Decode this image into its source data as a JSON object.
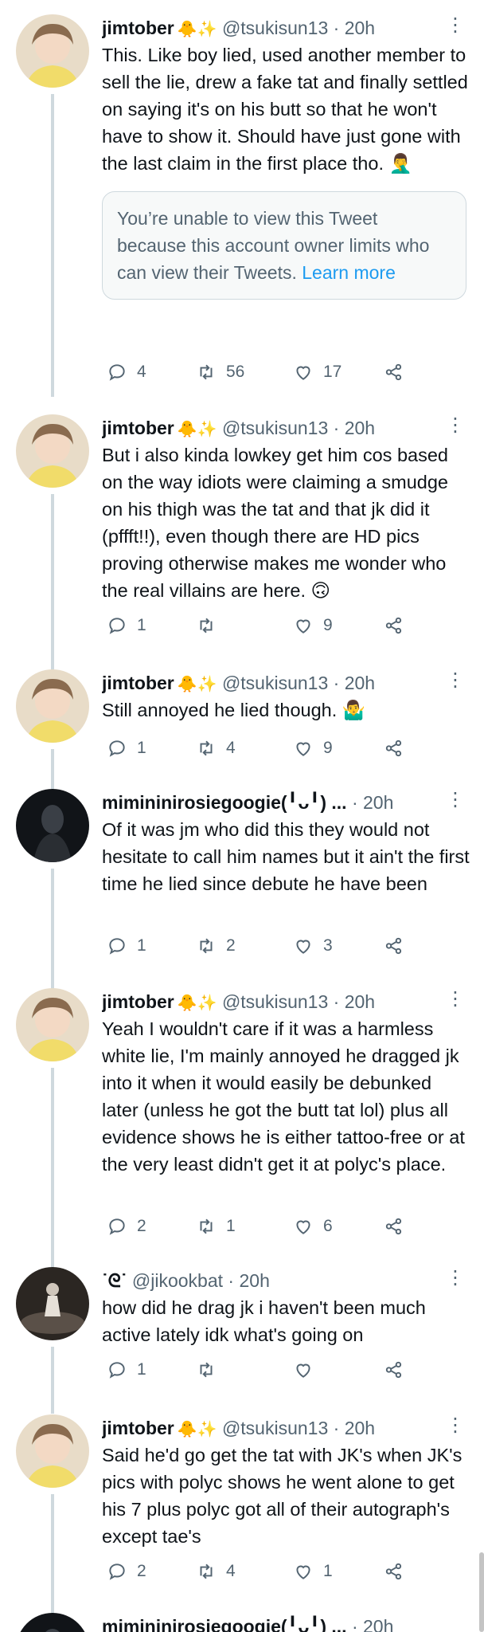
{
  "tweets": [
    {
      "name": "jimtober",
      "emoji": "🐥✨",
      "handle": "@tsukisun13",
      "sep": "·",
      "time": "20h",
      "text": "This. Like boy lied, used another member to sell the lie, drew a fake tat and finally settled on saying it's on his butt so that he won't have to show it. Should have just gone with the last claim in the first place tho. 🤦‍♂️",
      "quote": {
        "text": "You’re unable to view this Tweet because this account owner limits who can view their Tweets.",
        "link": "Learn more"
      },
      "replies": "4",
      "retweets": "56",
      "likes": "17"
    },
    {
      "name": "jimtober",
      "emoji": "🐥✨",
      "handle": "@tsukisun13",
      "sep": "·",
      "time": "20h",
      "text": "But i also kinda lowkey get him cos based on the way idiots were claiming a smudge on his thigh was the tat and that jk did it (pffft!!), even though there are HD pics proving otherwise makes me wonder who the real villains are here. 🙃",
      "replies": "1",
      "retweets": "",
      "likes": "9"
    },
    {
      "name": "jimtober",
      "emoji": "🐥✨",
      "handle": "@tsukisun13",
      "sep": "·",
      "time": "20h",
      "text": "Still annoyed he lied though. 🤷‍♂️",
      "replies": "1",
      "retweets": "4",
      "likes": "9"
    },
    {
      "name": "mimininirosiegoogie(╹ᴗ╹) ...",
      "emoji": "",
      "handle": "",
      "sep": "·",
      "time": "20h",
      "text": "Of it was jm who did this they would not hesitate to call him names but it ain't the first time he lied since debute he have been",
      "replies": "1",
      "retweets": "2",
      "likes": "3"
    },
    {
      "name": "jimtober",
      "emoji": "🐥✨",
      "handle": "@tsukisun13",
      "sep": "·",
      "time": "20h",
      "text": "Yeah I wouldn't care if it was a harmless white lie, I'm mainly annoyed he dragged jk into it when it would easily be debunked later (unless he got the butt tat lol) plus all evidence shows he is either tattoo-free or at the very least didn't get it at polyc's place.",
      "replies": "2",
      "retweets": "1",
      "likes": "6"
    },
    {
      "name": "˙ᘓ˙",
      "emoji": "",
      "handle": "@jikookbat",
      "sep": "·",
      "time": "20h",
      "text": "how did he drag jk i haven't been much active lately idk what's going on",
      "replies": "1",
      "retweets": "",
      "likes": ""
    },
    {
      "name": "jimtober",
      "emoji": "🐥✨",
      "handle": "@tsukisun13",
      "sep": "·",
      "time": "20h",
      "text": "Said he'd go get the tat with JK's when JK's pics with polyc shows he went alone to get his 7 plus polyc got all of their autograph's except tae's",
      "replies": "2",
      "retweets": "4",
      "likes": "1"
    },
    {
      "name": "mimininirosiegoogie(╹ᴗ╹) ...",
      "emoji": "",
      "handle": "",
      "sep": "·",
      "time": "20h",
      "text": "",
      "replies": "",
      "retweets": "",
      "likes": ""
    }
  ],
  "colors": {
    "text": "#0f1419",
    "secondary": "#536471",
    "link": "#1d9bf0",
    "line": "#cfd9de"
  },
  "icons": {
    "reply": "reply-icon",
    "retweet": "retweet-icon",
    "like": "heart-icon",
    "share": "share-icon",
    "more": "more-icon"
  }
}
